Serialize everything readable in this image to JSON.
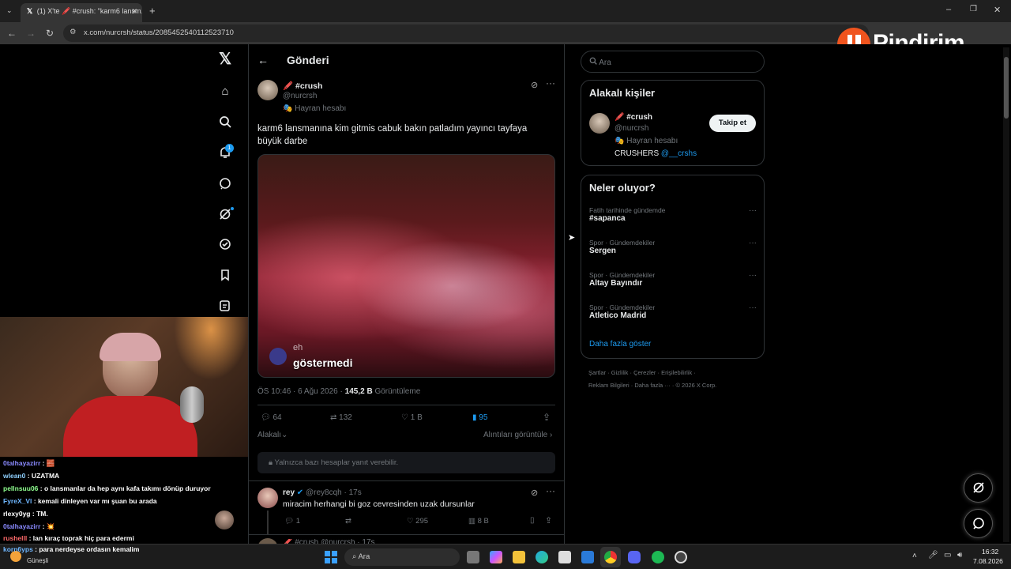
{
  "browser": {
    "tab_title": "(1) X'te 🖍️ #crush: \"karm6 lansm…",
    "url": "x.com/nurcrsh/status/2085452540112523710"
  },
  "overlay": {
    "brand": "Pindirim"
  },
  "post": {
    "header_title": "Gönderi",
    "author_name": "🖍️ #crush",
    "author_handle": "@nurcrsh",
    "fan_label": "🎭 Hayran hesabı",
    "text": "karm6 lansmanına kim gitmis cabuk bakın patladım yayıncı tayfaya büyük darbe",
    "media_caption": "göstermedi",
    "media_caption_small": "eh",
    "time": "ÖS 10:46 · 6 Ağu 2026 ·",
    "views_count": "145,2 B",
    "views_label": "Görüntüleme",
    "replies": "64",
    "reposts": "132",
    "likes": "1 B",
    "bookmarks": "95",
    "sort_label": "Alakalı",
    "quotes_link": "Alıntıları görüntüle",
    "reply_restriction": "Yalnızca bazı hesaplar yanıt verebilir."
  },
  "reply": {
    "name": "rey",
    "handle": "@rey8cqh · 17s",
    "text": "miracim herhangi bi goz cevresinden uzak dursunlar",
    "replies": "1",
    "likes": "295",
    "views": "8 B",
    "next_preview": "🖍️ #crush @nurcrsh · 17s"
  },
  "search": {
    "placeholder": "Ara"
  },
  "related": {
    "title": "Alakalı kişiler",
    "name": "🖍️ #crush",
    "handle": "@nurcrsh",
    "fan_label": "🎭 Hayran hesabı",
    "bio_prefix": "CRUSHERS",
    "bio_link": "@__crshs",
    "follow_label": "Takip et"
  },
  "trends": {
    "title": "Neler oluyor?",
    "items": [
      {
        "sub": "Fatih tarihinde gündemde",
        "main": "#sapanca"
      },
      {
        "sub": "Spor · Gündemdekiler",
        "main": "Sergen"
      },
      {
        "sub": "Spor · Gündemdekiler",
        "main": "Altay Bayındır"
      },
      {
        "sub": "Spor · Gündemdekiler",
        "main": "Atletico Madrid"
      }
    ],
    "more": "Daha fazla göster"
  },
  "footer": {
    "line1": "Şartlar · Gizlilik · Çerezler · Erişilebilirlik ·",
    "line2": "Reklam Bilgileri · Daha fazla ··· · © 2026 X Corp."
  },
  "notification_badge": "1",
  "chat": [
    {
      "user": "0talhayazirr",
      "msg": ": 🧱",
      "color": "#8a8aff"
    },
    {
      "user": "wlean0",
      "msg": ": UZATMA",
      "color": "#8fd0ff"
    },
    {
      "user": "pellnsuu06",
      "msg": ": o lansmanlar da hep aynı kafa takımı dönüp duruyor",
      "color": "#8fff8f"
    },
    {
      "user": "FyreX_Vl",
      "msg": ": kemali dinleyen var mı şuan bu arada",
      "color": "#6fb7ff"
    },
    {
      "user": "rlexy0yg",
      "msg": ": TM.",
      "color": "#ffffff"
    },
    {
      "user": "0talhayazirr",
      "msg": ": 💥",
      "color": "#8a8aff"
    },
    {
      "user": "rushelll",
      "msg": ": lan kıraç toprak hiç para edermi",
      "color": "#ff6a6a"
    },
    {
      "user": "korn6yps",
      "msg": ": para nerdeyse ordasın kemalim",
      "color": "#6fb7ff"
    }
  ],
  "taskbar": {
    "weather": "Güneşli",
    "search": "Ara",
    "time": "16:32",
    "date": "7.08.2026"
  },
  "colors": {
    "accent": "#1d9bf0",
    "bg": "#000000",
    "border": "#2f3336"
  }
}
